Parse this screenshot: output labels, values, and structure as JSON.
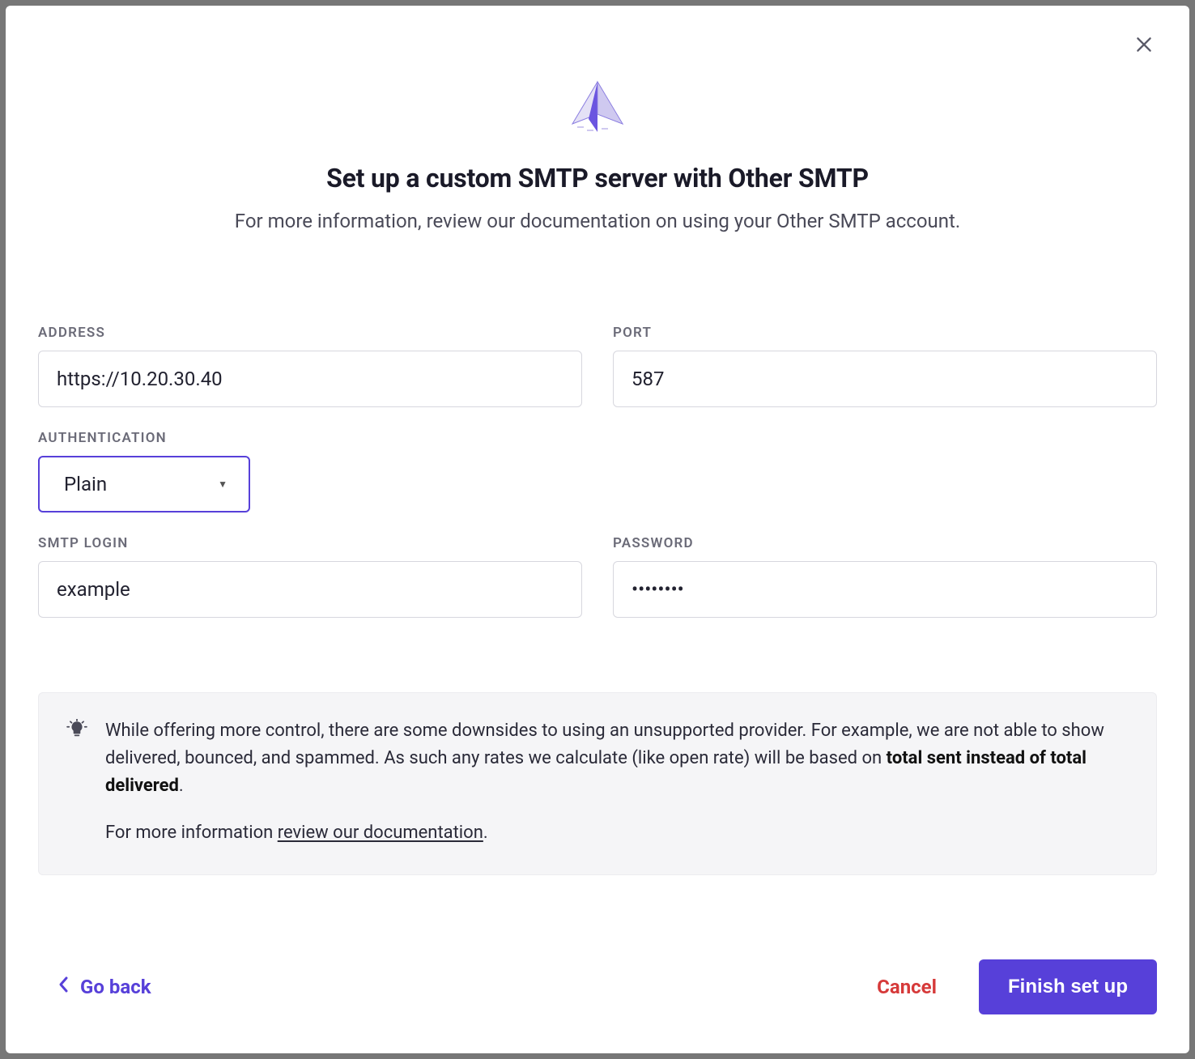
{
  "header": {
    "title": "Set up a custom SMTP server with Other SMTP",
    "subtitle": "For more information, review our documentation on using your Other SMTP account."
  },
  "form": {
    "address": {
      "label": "ADDRESS",
      "value": "https://10.20.30.40"
    },
    "port": {
      "label": "PORT",
      "value": "587"
    },
    "auth": {
      "label": "AUTHENTICATION",
      "value": "Plain"
    },
    "login": {
      "label": "SMTP LOGIN",
      "value": "example"
    },
    "password": {
      "label": "PASSWORD",
      "value": "••••••••"
    }
  },
  "info": {
    "p1_before": "While offering more control, there are some downsides to using an unsupported provider. For example, we are not able to show delivered, bounced, and spammed. As such any rates we calculate (like open rate) will be based on ",
    "p1_strong": "total sent instead of total delivered",
    "p1_after": ".",
    "p2_before": "For more information ",
    "p2_link": "review our documentation",
    "p2_after": "."
  },
  "footer": {
    "back": "Go back",
    "cancel": "Cancel",
    "finish": "Finish set up"
  }
}
